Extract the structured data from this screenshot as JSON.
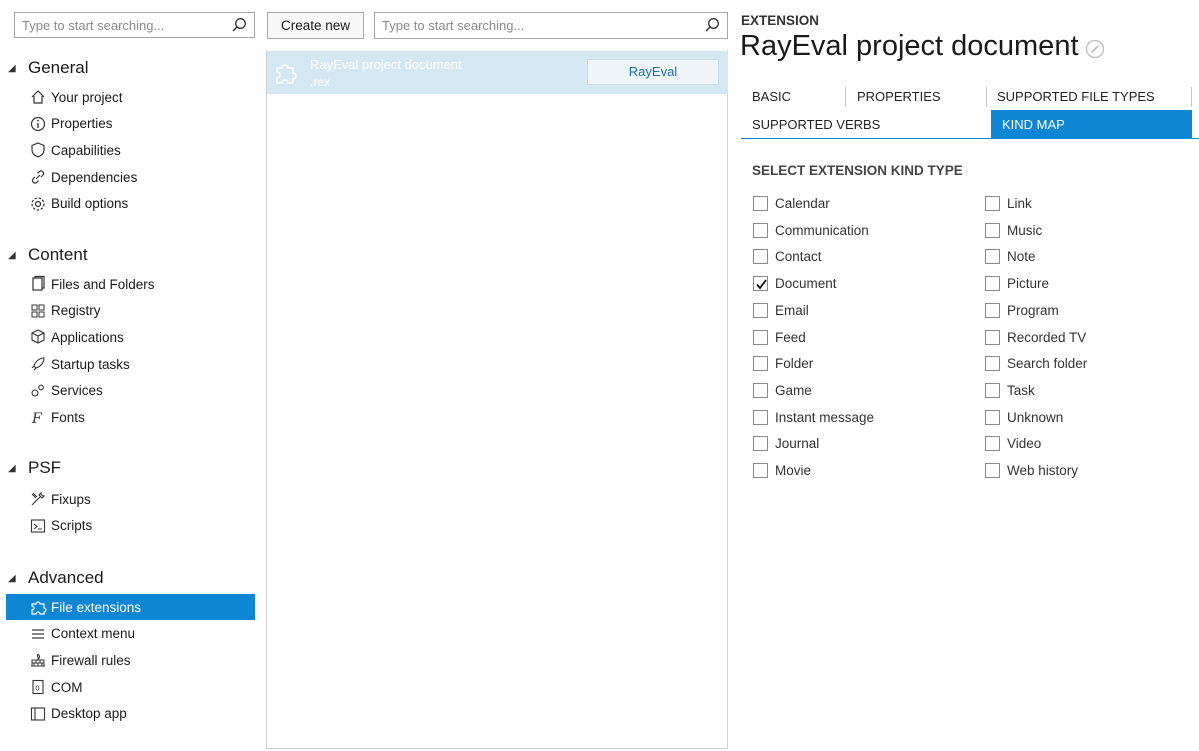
{
  "left_nav": {
    "search_placeholder": "Type to start searching...",
    "groups": [
      {
        "label": "General",
        "items": [
          {
            "label": "Your project",
            "icon": "home-icon"
          },
          {
            "label": "Properties",
            "icon": "info-icon"
          },
          {
            "label": "Capabilities",
            "icon": "shield-icon"
          },
          {
            "label": "Dependencies",
            "icon": "link-icon"
          },
          {
            "label": "Build options",
            "icon": "gear-icon"
          }
        ]
      },
      {
        "label": "Content",
        "items": [
          {
            "label": "Files and Folders",
            "icon": "files-icon"
          },
          {
            "label": "Registry",
            "icon": "registry-icon"
          },
          {
            "label": "Applications",
            "icon": "package-icon"
          },
          {
            "label": "Startup tasks",
            "icon": "rocket-icon"
          },
          {
            "label": "Services",
            "icon": "services-icon"
          },
          {
            "label": "Fonts",
            "icon": "font-icon"
          }
        ]
      },
      {
        "label": "PSF",
        "items": [
          {
            "label": "Fixups",
            "icon": "tools-icon"
          },
          {
            "label": "Scripts",
            "icon": "script-icon"
          }
        ]
      },
      {
        "label": "Advanced",
        "items": [
          {
            "label": "File extensions",
            "icon": "puzzle-icon",
            "active": true
          },
          {
            "label": "Context menu",
            "icon": "menu-icon"
          },
          {
            "label": "Firewall rules",
            "icon": "firewall-icon"
          },
          {
            "label": "COM",
            "icon": "com-icon"
          },
          {
            "label": "Desktop app",
            "icon": "desktop-icon"
          }
        ]
      }
    ]
  },
  "middle": {
    "create_new_label": "Create new",
    "search_placeholder": "Type to start searching...",
    "rows": [
      {
        "title": "RayEval project document",
        "sub": ".rex",
        "tag": "RayEval",
        "icon": "puzzle-icon"
      }
    ]
  },
  "detail": {
    "eyebrow": "EXTENSION",
    "title": "RayEval project document",
    "edit_icon": "pencil-icon",
    "tabs": [
      {
        "label": "BASIC"
      },
      {
        "label": "PROPERTIES"
      },
      {
        "label": "SUPPORTED FILE TYPES"
      },
      {
        "label": "SUPPORTED VERBS"
      },
      {
        "label": "KIND MAP",
        "active": true
      }
    ],
    "section_title": "SELECT EXTENSION KIND TYPE",
    "kinds_col1": [
      {
        "label": "Calendar",
        "checked": false
      },
      {
        "label": "Communication",
        "checked": false
      },
      {
        "label": "Contact",
        "checked": false
      },
      {
        "label": "Document",
        "checked": true
      },
      {
        "label": "Email",
        "checked": false
      },
      {
        "label": "Feed",
        "checked": false
      },
      {
        "label": "Folder",
        "checked": false
      },
      {
        "label": "Game",
        "checked": false
      },
      {
        "label": "Instant message",
        "checked": false
      },
      {
        "label": "Journal",
        "checked": false
      },
      {
        "label": "Movie",
        "checked": false
      }
    ],
    "kinds_col2": [
      {
        "label": "Link",
        "checked": false
      },
      {
        "label": "Music",
        "checked": false
      },
      {
        "label": "Note",
        "checked": false
      },
      {
        "label": "Picture",
        "checked": false
      },
      {
        "label": "Program",
        "checked": false
      },
      {
        "label": "Recorded TV",
        "checked": false
      },
      {
        "label": "Search folder",
        "checked": false
      },
      {
        "label": "Task",
        "checked": false
      },
      {
        "label": "Unknown",
        "checked": false
      },
      {
        "label": "Video",
        "checked": false
      },
      {
        "label": "Web history",
        "checked": false
      }
    ]
  },
  "colors": {
    "accent": "#0f86d4",
    "selected_row": "#d3e8f3"
  }
}
